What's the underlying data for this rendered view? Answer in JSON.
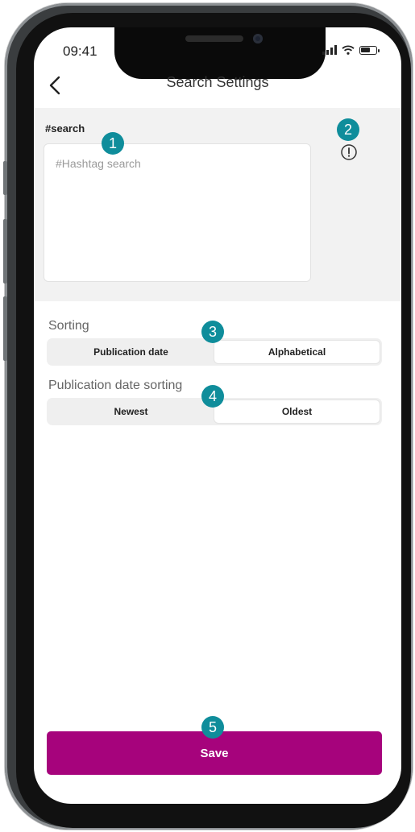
{
  "status_bar": {
    "time": "09:41"
  },
  "nav": {
    "title": "Search Settings",
    "back_icon": "chevron-left-icon"
  },
  "search": {
    "label": "#search",
    "placeholder": "#Hashtag search",
    "value": "",
    "info_icon": "exclamation-circle-icon"
  },
  "sorting": {
    "label": "Sorting",
    "options": [
      "Publication date",
      "Alphabetical"
    ],
    "selected": "Publication date"
  },
  "date_sorting": {
    "label": "Publication date sorting",
    "options": [
      "Newest",
      "Oldest"
    ],
    "selected": "Newest"
  },
  "save_label": "Save",
  "annotations": [
    "1",
    "2",
    "3",
    "4",
    "5"
  ],
  "colors": {
    "accent": "#a6037c",
    "badge": "#0f8d9b",
    "panel": "#f2f2f2"
  }
}
